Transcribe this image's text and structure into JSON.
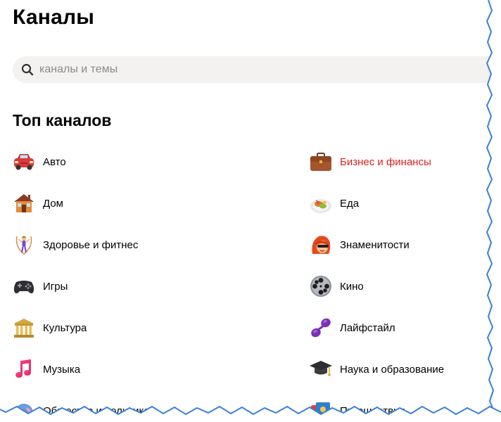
{
  "page": {
    "title": "Каналы"
  },
  "search": {
    "placeholder": "каналы и темы"
  },
  "top_channels": {
    "title": "Топ каналов",
    "left_column": [
      {
        "label": "Авто",
        "icon": "car-icon"
      },
      {
        "label": "Дом",
        "icon": "house-icon"
      },
      {
        "label": "Здоровье и фитнес",
        "icon": "jump-rope-person-icon"
      },
      {
        "label": "Игры",
        "icon": "gamepad-icon"
      },
      {
        "label": "Культура",
        "icon": "museum-icon"
      },
      {
        "label": "Музыка",
        "icon": "music-note-icon"
      },
      {
        "label": "Общество и политика",
        "icon": "globe-icon"
      }
    ],
    "right_column": [
      {
        "label": "Бизнес и финансы",
        "icon": "briefcase-icon",
        "highlight_color": "#e02020"
      },
      {
        "label": "Еда",
        "icon": "food-plate-icon"
      },
      {
        "label": "Знаменитости",
        "icon": "celebrity-icon"
      },
      {
        "label": "Кино",
        "icon": "film-reel-icon"
      },
      {
        "label": "Лайфстайл",
        "icon": "sunglasses-icon"
      },
      {
        "label": "Наука и образование",
        "icon": "graduation-cap-icon"
      },
      {
        "label": "Путешествия",
        "icon": "travel-map-icon"
      }
    ]
  }
}
